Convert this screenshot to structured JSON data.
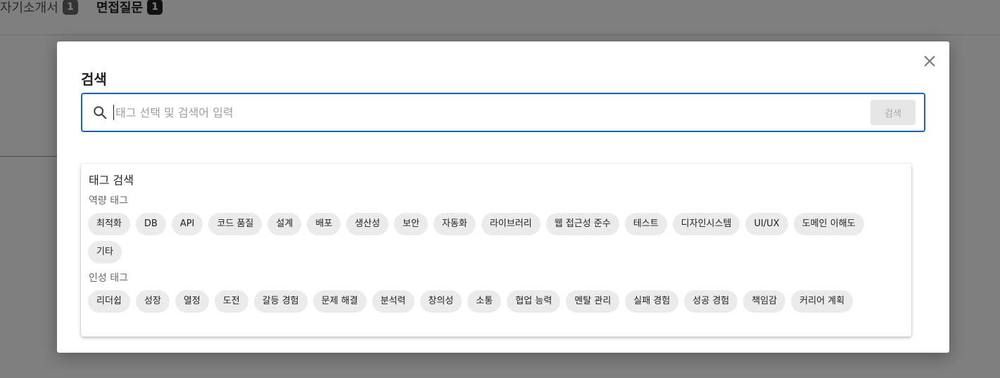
{
  "background": {
    "tabs": [
      {
        "label": "자기소개서",
        "count": "1",
        "active": false
      },
      {
        "label": "면접질문",
        "count": "1",
        "active": true
      }
    ]
  },
  "modal": {
    "title": "검색",
    "close_icon": "close-icon",
    "search": {
      "placeholder": "태그 선택 및 검색어 입력",
      "value": "",
      "button_label": "검색",
      "icon": "search-icon"
    },
    "tag_panel": {
      "title": "태그 검색",
      "groups": [
        {
          "label": "역량 태그",
          "tags": [
            "최적화",
            "DB",
            "API",
            "코드 품질",
            "설계",
            "배포",
            "생산성",
            "보안",
            "자동화",
            "라이브러리",
            "웹 접근성 준수",
            "테스트",
            "디자인시스템",
            "UI/UX",
            "도메인 이해도",
            "기타"
          ]
        },
        {
          "label": "인성 태그",
          "tags": [
            "리더쉽",
            "성장",
            "열정",
            "도전",
            "갈등 경험",
            "문제 해결",
            "분석력",
            "창의성",
            "소통",
            "협업 능력",
            "멘탈 관리",
            "실패 경험",
            "성공 경험",
            "책임감",
            "커리어 계획"
          ]
        }
      ]
    }
  },
  "colors": {
    "accent": "#1565c0",
    "chip_bg": "#ebebeb",
    "overlay": "rgba(0,0,0,0.5)"
  }
}
